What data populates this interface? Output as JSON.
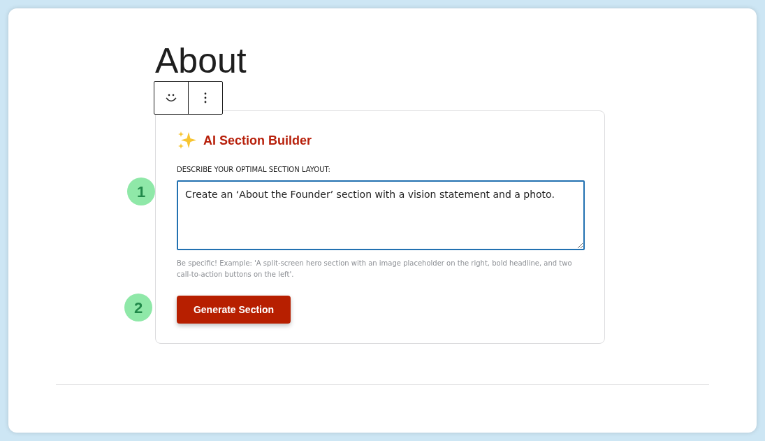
{
  "heading": "About",
  "builder": {
    "title": "AI Section Builder",
    "field_label": "DESCRIBE YOUR OPTIMAL SECTION LAYOUT:",
    "prompt_value": "Create an ‘About the Founder’ section with a vision statement and a photo.",
    "hint": "Be specific! Example: 'A split-screen hero section with an image placeholder on the right, bold headline, and two call-to-action buttons on the left'.",
    "button": "Generate Section"
  },
  "steps": [
    "1",
    "2"
  ]
}
